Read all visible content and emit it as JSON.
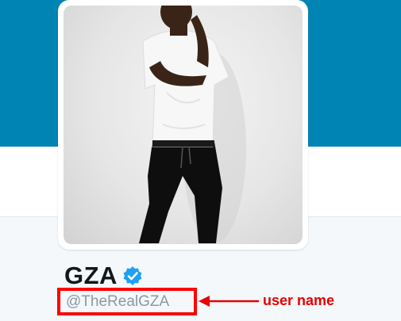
{
  "profile": {
    "display_name": "GZA",
    "verified": true,
    "handle": "@TheRealGZA",
    "avatar_icon": "profile-photo-person"
  },
  "annotation": {
    "label": "user name",
    "color": "#e60000"
  },
  "colors": {
    "banner": "#0084b4",
    "verified_badge": "#1da1f2",
    "handle_text": "#8899a6"
  }
}
